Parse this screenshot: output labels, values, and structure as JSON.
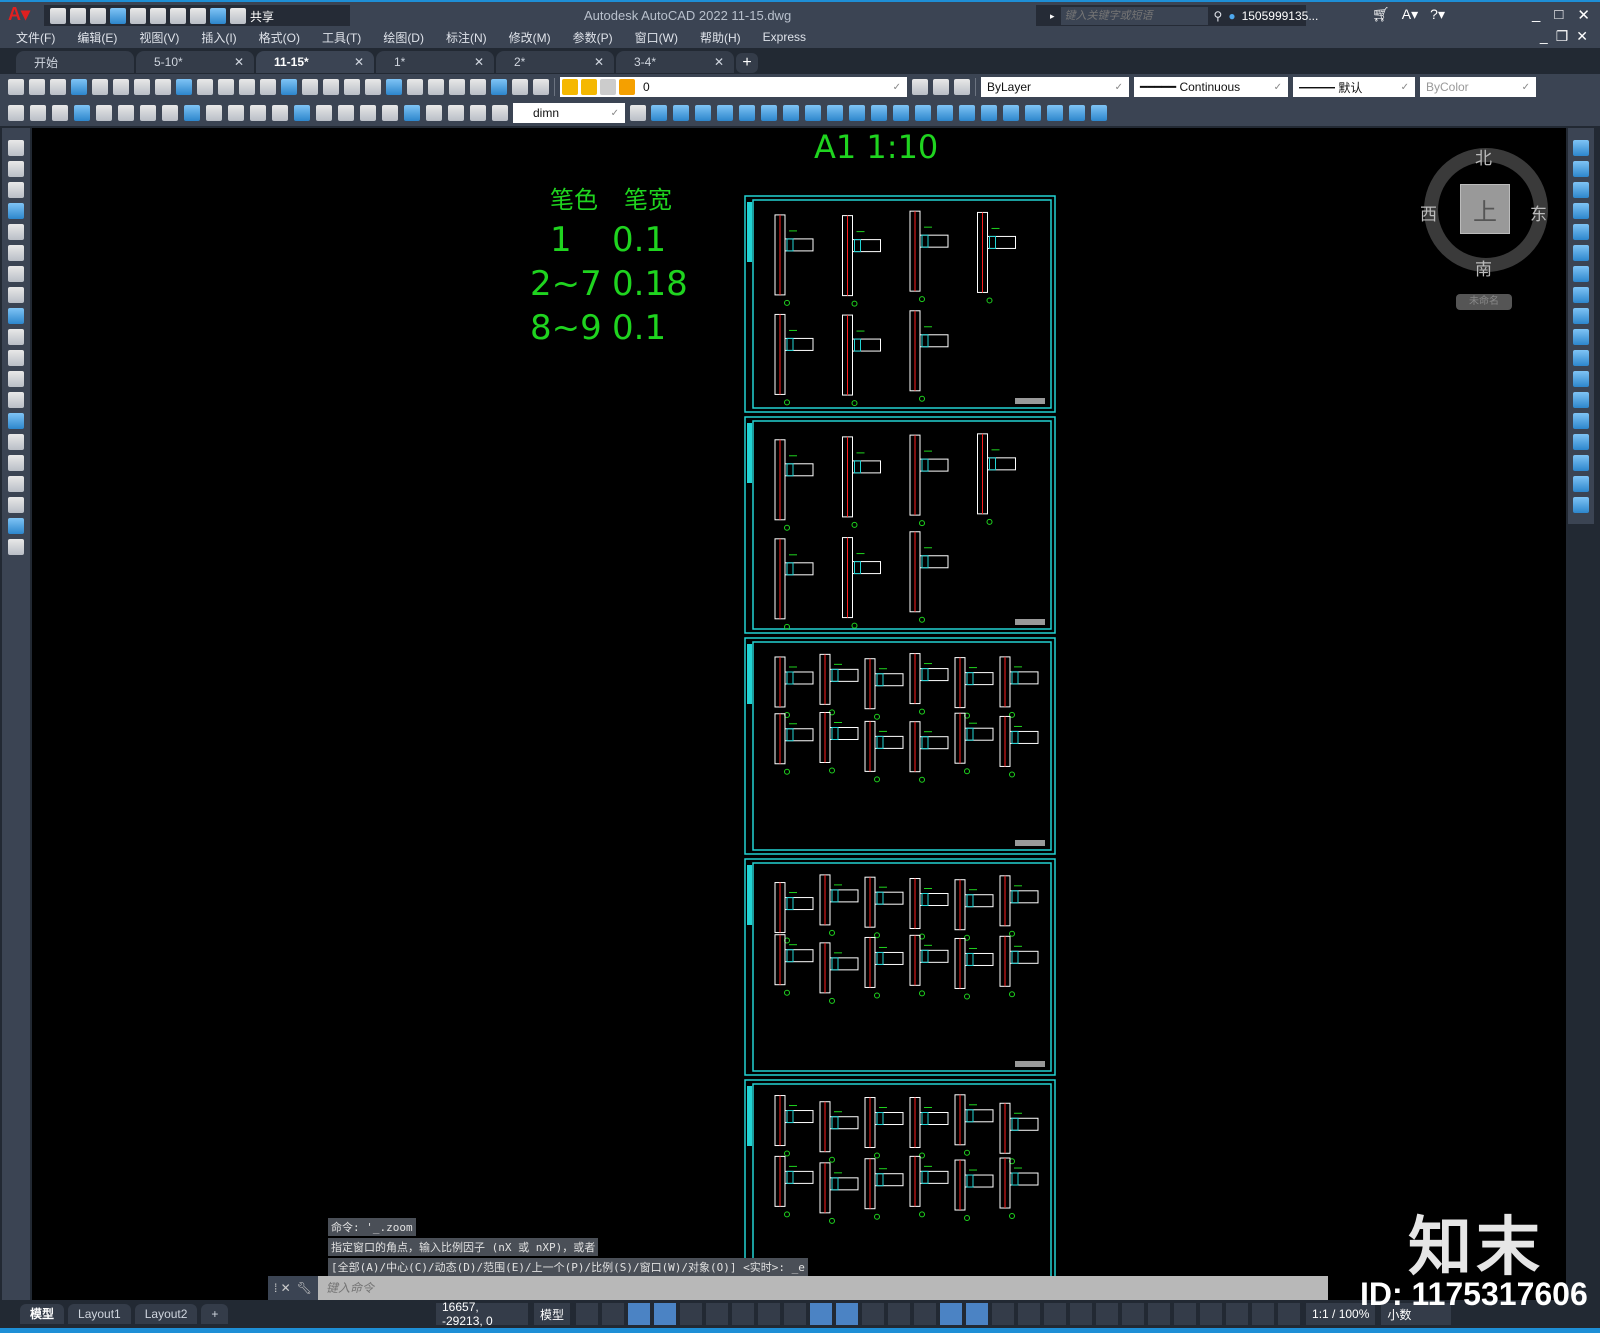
{
  "titlebar": {
    "app_icon": "autocad-logo-icon",
    "title": "Autodesk AutoCAD 2022    11-15.dwg",
    "share": "共享",
    "search_placeholder": "键入关键字或短语",
    "user": "1505999135...",
    "qat_icons": [
      "new-icon",
      "open-icon",
      "save-icon",
      "save-as-icon",
      "plot-preview-icon",
      "publish-icon",
      "print-icon",
      "undo-icon",
      "redo-icon",
      "customize-icon"
    ]
  },
  "menu": [
    "文件(F)",
    "编辑(E)",
    "视图(V)",
    "插入(I)",
    "格式(O)",
    "工具(T)",
    "绘图(D)",
    "标注(N)",
    "修改(M)",
    "参数(P)",
    "窗口(W)",
    "帮助(H)",
    "Express"
  ],
  "tabs": [
    {
      "label": "开始",
      "closable": false
    },
    {
      "label": "5-10*",
      "closable": true
    },
    {
      "label": "11-15*",
      "closable": true,
      "active": true
    },
    {
      "label": "1*",
      "closable": true
    },
    {
      "label": "2*",
      "closable": true
    },
    {
      "label": "3-4*",
      "closable": true
    }
  ],
  "toolbar1": {
    "icons": [
      "new-icon",
      "open-icon",
      "save-icon",
      "print-icon",
      "plot-preview-icon",
      "publish-icon",
      "3d-dwf-icon",
      "cut-icon",
      "copy-icon",
      "paste-icon",
      "match-properties-icon",
      "block-editor-icon",
      "undo-icon",
      "redo-icon",
      "pan-icon",
      "zoom-realtime-icon",
      "zoom-window-icon",
      "zoom-previous-icon",
      "properties-icon",
      "design-center-icon",
      "tool-palettes-icon",
      "sheet-set-icon",
      "markup-icon",
      "calculator-icon",
      "help-icon",
      "layer-properties-icon"
    ],
    "layer": "0",
    "layer_icons": [
      "layer-on-icon",
      "layer-freeze-icon",
      "layer-viewport-icon",
      "layer-lock-icon"
    ],
    "color": "ByLayer",
    "linetype": "Continuous",
    "lineweight": "默认",
    "plotstyle": "ByColor"
  },
  "toolbar2": {
    "icons": [
      "dim-edit-icon",
      "dim-check-icon",
      "dim-layer-icon",
      "linear-dim-icon",
      "aligned-dim-icon",
      "arc-length-icon",
      "ordinate-icon",
      "radius-icon",
      "jogged-icon",
      "diameter-icon",
      "angular-icon",
      "quick-dim-icon",
      "baseline-icon",
      "continue-icon",
      "dim-space-icon",
      "dim-break-icon",
      "tolerance-icon",
      "center-mark-icon",
      "inspect-icon",
      "jogged-linear-icon",
      "dim-edit2-icon",
      "dim-text-edit-icon",
      "dim-update-icon"
    ],
    "dimstyle": "dimn",
    "modify_icons": [
      "erase-icon",
      "copy-obj-icon",
      "mirror-icon",
      "offset-icon",
      "array-icon",
      "move-icon",
      "rotate-icon",
      "scale-icon",
      "stretch-icon",
      "trim-icon",
      "extend-icon",
      "break-icon",
      "join-icon",
      "chamfer-icon",
      "fillet-icon",
      "blend-icon",
      "explode-icon",
      "rectangle-icon",
      "box-icon",
      "wedge-icon",
      "cylinder-icon"
    ]
  },
  "leftbar": [
    "line-icon",
    "construction-line-icon",
    "polyline-icon",
    "polygon-icon",
    "rectangle-icon",
    "arc-icon",
    "circle-icon",
    "revision-cloud-icon",
    "spline-icon",
    "ellipse-icon",
    "ellipse-arc-icon",
    "insert-block-icon",
    "make-block-icon",
    "point-icon",
    "hatch-icon",
    "gradient-icon",
    "region-icon",
    "table-icon",
    "text-icon",
    "add-selected-icon"
  ],
  "rightbar": [
    "erase-icon",
    "copy-icon",
    "mirror-icon",
    "offset-icon",
    "array-icon",
    "move-icon",
    "rotate-icon",
    "scale-icon",
    "stretch-icon",
    "trim-icon",
    "extend-icon",
    "break-at-point-icon",
    "break-icon",
    "join-icon",
    "chamfer-icon",
    "fillet-icon",
    "blend-icon",
    "explode-icon"
  ],
  "drawing": {
    "scale_title": "A1  1:10",
    "pen_header": [
      "笔色",
      "笔宽"
    ],
    "pen_rows": [
      [
        "1",
        "0.1"
      ],
      [
        "2~7",
        "0.18"
      ],
      [
        "8~9",
        "0.1"
      ]
    ],
    "sheet_count": 5,
    "colors": {
      "frame": "#22d3d3",
      "text": "#1fd41f",
      "line": "#ffffff",
      "axis": "#ff2020"
    }
  },
  "viewcube": {
    "north": "北",
    "south": "南",
    "east": "东",
    "west": "西",
    "face": "上",
    "ucs": "未命名"
  },
  "command": {
    "history": [
      "命令: '_.zoom",
      "指定窗口的角点，输入比例因子 (nX 或 nXP)，或者",
      "[全部(A)/中心(C)/动态(D)/范围(E)/上一个(P)/比例(S)/窗口(W)/对象(O)] <实时>: _e"
    ],
    "placeholder": "键入命令"
  },
  "layout_tabs": [
    "模型",
    "Layout1",
    "Layout2"
  ],
  "status": {
    "coords": "16657, -29213, 0",
    "space": "模型",
    "annotation_scale": "1:1 / 100%",
    "units": "小数",
    "icons": [
      "grid-icon",
      "snap-icon",
      "infer-icon",
      "dynamic-input-icon",
      "ortho-icon",
      "polar-icon",
      "isodraft-icon",
      "osnap-tracking-icon",
      "osnap-icon",
      "lineweight-icon",
      "transparency-icon",
      "selection-cycling-icon",
      "3d-osnap-icon",
      "dynamic-ucs-icon",
      "selection-filter-icon",
      "gizmo-icon",
      "annotation-visibility-icon",
      "auto-scale-icon",
      "annotation-scale-icon",
      "workspace-icon",
      "annotation-monitor-icon",
      "units-icon",
      "quick-properties-icon",
      "lock-ui-icon",
      "isolate-icon",
      "hardware-accel-icon",
      "clean-screen-icon",
      "customize-icon"
    ]
  },
  "watermark": {
    "logo": "知末",
    "id": "ID: 1175317606"
  }
}
